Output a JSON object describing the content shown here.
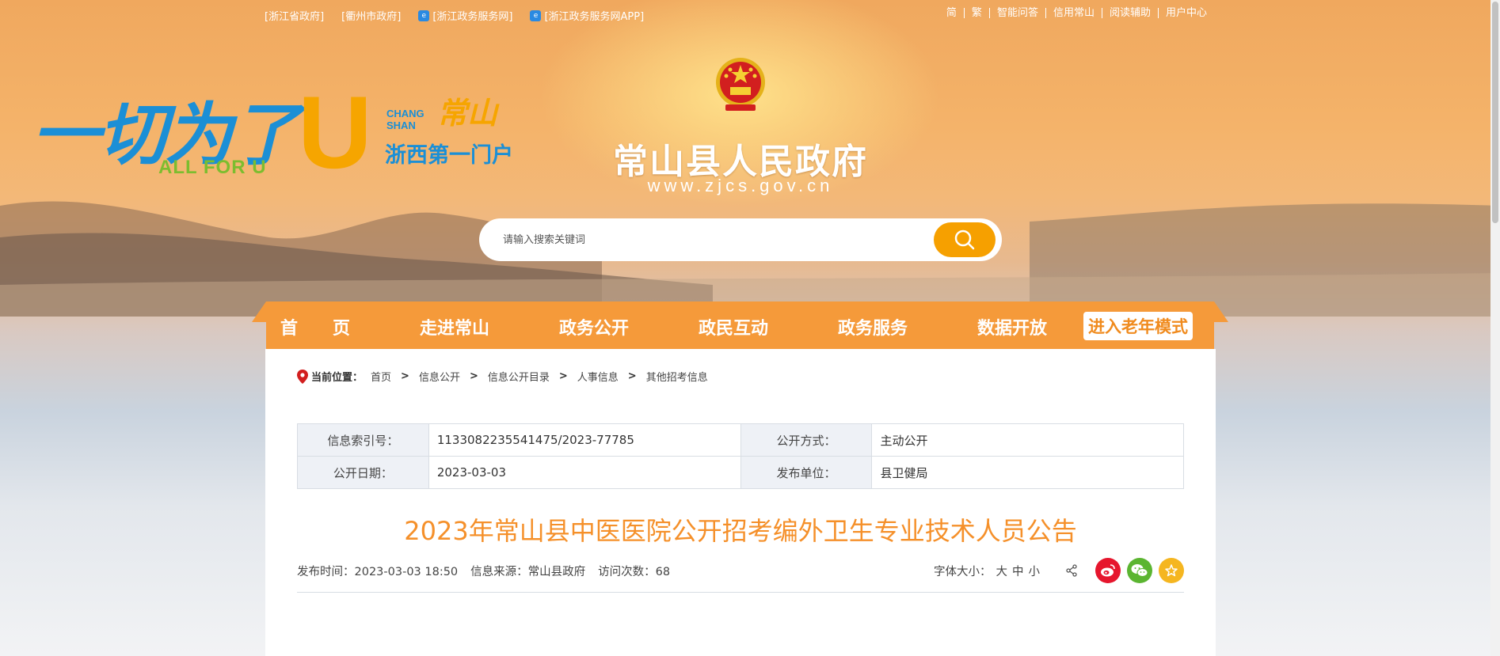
{
  "topbar": {
    "left_links": [
      "[浙江省政府]",
      "[衢州市政府]",
      "[浙江政务服务网]",
      "[浙江政务服务网APP]"
    ],
    "right_links": [
      "简",
      "繁",
      "智能问答",
      "信用常山",
      "阅读辅助",
      "用户中心"
    ]
  },
  "slogan": {
    "main": "一切为了",
    "u_letter": "U",
    "english": "ALL FOR U",
    "chang_shan": "CHANG SHAN",
    "cs_script": "常山",
    "portal": "浙西第一门户"
  },
  "site": {
    "title": "常山县人民政府",
    "url": "www.zjcs.gov.cn"
  },
  "search": {
    "placeholder": "请输入搜索关键词"
  },
  "nav": {
    "items": [
      "首　　页",
      "走进常山",
      "政务公开",
      "政民互动",
      "政务服务",
      "数据开放"
    ],
    "elder_mode": "进入老年模式"
  },
  "breadcrumb": {
    "label": "当前位置：",
    "items": [
      "首页",
      "信息公开",
      "信息公开目录",
      "人事信息",
      "其他招考信息"
    ],
    "separator": ">"
  },
  "meta": {
    "index_label": "信息索引号：",
    "index_value": "1133082235541475/2023-77785",
    "method_label": "公开方式：",
    "method_value": "主动公开",
    "date_label": "公开日期：",
    "date_value": "2023-03-03",
    "unit_label": "发布单位：",
    "unit_value": "县卫健局"
  },
  "article": {
    "title": "2023年常山县中医医院公开招考编外卫生专业技术人员公告",
    "publish_time": "发布时间：2023-03-03 18:50",
    "source": "信息来源：常山县政府",
    "visits": "访问次数：68",
    "font_size_label": "字体大小：",
    "font_large": "大",
    "font_medium": "中",
    "font_small": "小"
  },
  "colors": {
    "nav_orange": "#f59a3a",
    "title_orange": "#f5902a",
    "search_btn": "#f6a000",
    "weibo_red": "#e6162d",
    "wechat_green": "#5bb531",
    "fav_yellow": "#f5b620"
  },
  "icons": [
    "location-icon",
    "search-icon",
    "share-icon",
    "weibo-icon",
    "wechat-icon",
    "favorite-icon",
    "national-emblem"
  ]
}
